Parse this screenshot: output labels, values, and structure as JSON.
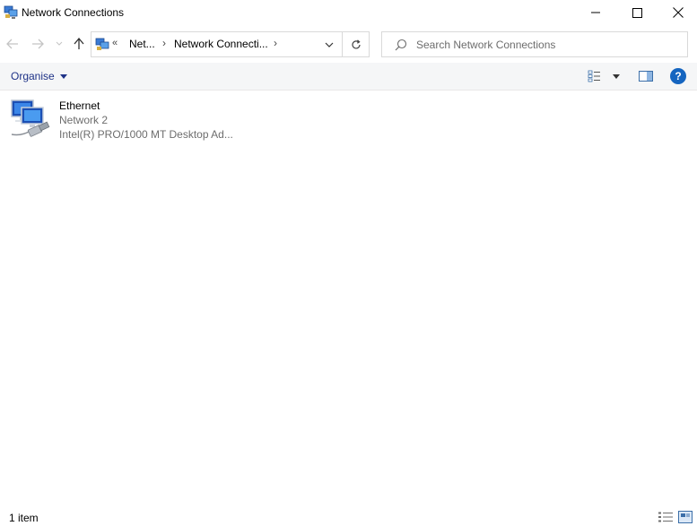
{
  "window": {
    "title": "Network Connections"
  },
  "navigation": {
    "address_prefix": "«",
    "breadcrumbs": [
      {
        "label": "Net..."
      },
      {
        "label": "Network Connecti..."
      }
    ],
    "separator": "›"
  },
  "search": {
    "placeholder": "Search Network Connections",
    "value": ""
  },
  "toolbar": {
    "organise_label": "Organise",
    "help_label": "?"
  },
  "items": [
    {
      "name": "Ethernet",
      "network": "Network 2",
      "adapter": "Intel(R) PRO/1000 MT Desktop Ad..."
    }
  ],
  "status": {
    "item_count": "1 item"
  },
  "colors": {
    "accent": "#1e3287",
    "help": "#1565c0",
    "secondary_text": "#6d6d6d"
  },
  "icons": {
    "app": "network-connections-icon",
    "back": "back-arrow-icon",
    "forward": "forward-arrow-icon",
    "up": "up-arrow-icon",
    "refresh": "refresh-icon",
    "search": "search-icon",
    "view": "change-view-icon",
    "preview_pane": "preview-pane-icon",
    "help": "help-icon",
    "ethernet": "network-adapter-icon"
  }
}
